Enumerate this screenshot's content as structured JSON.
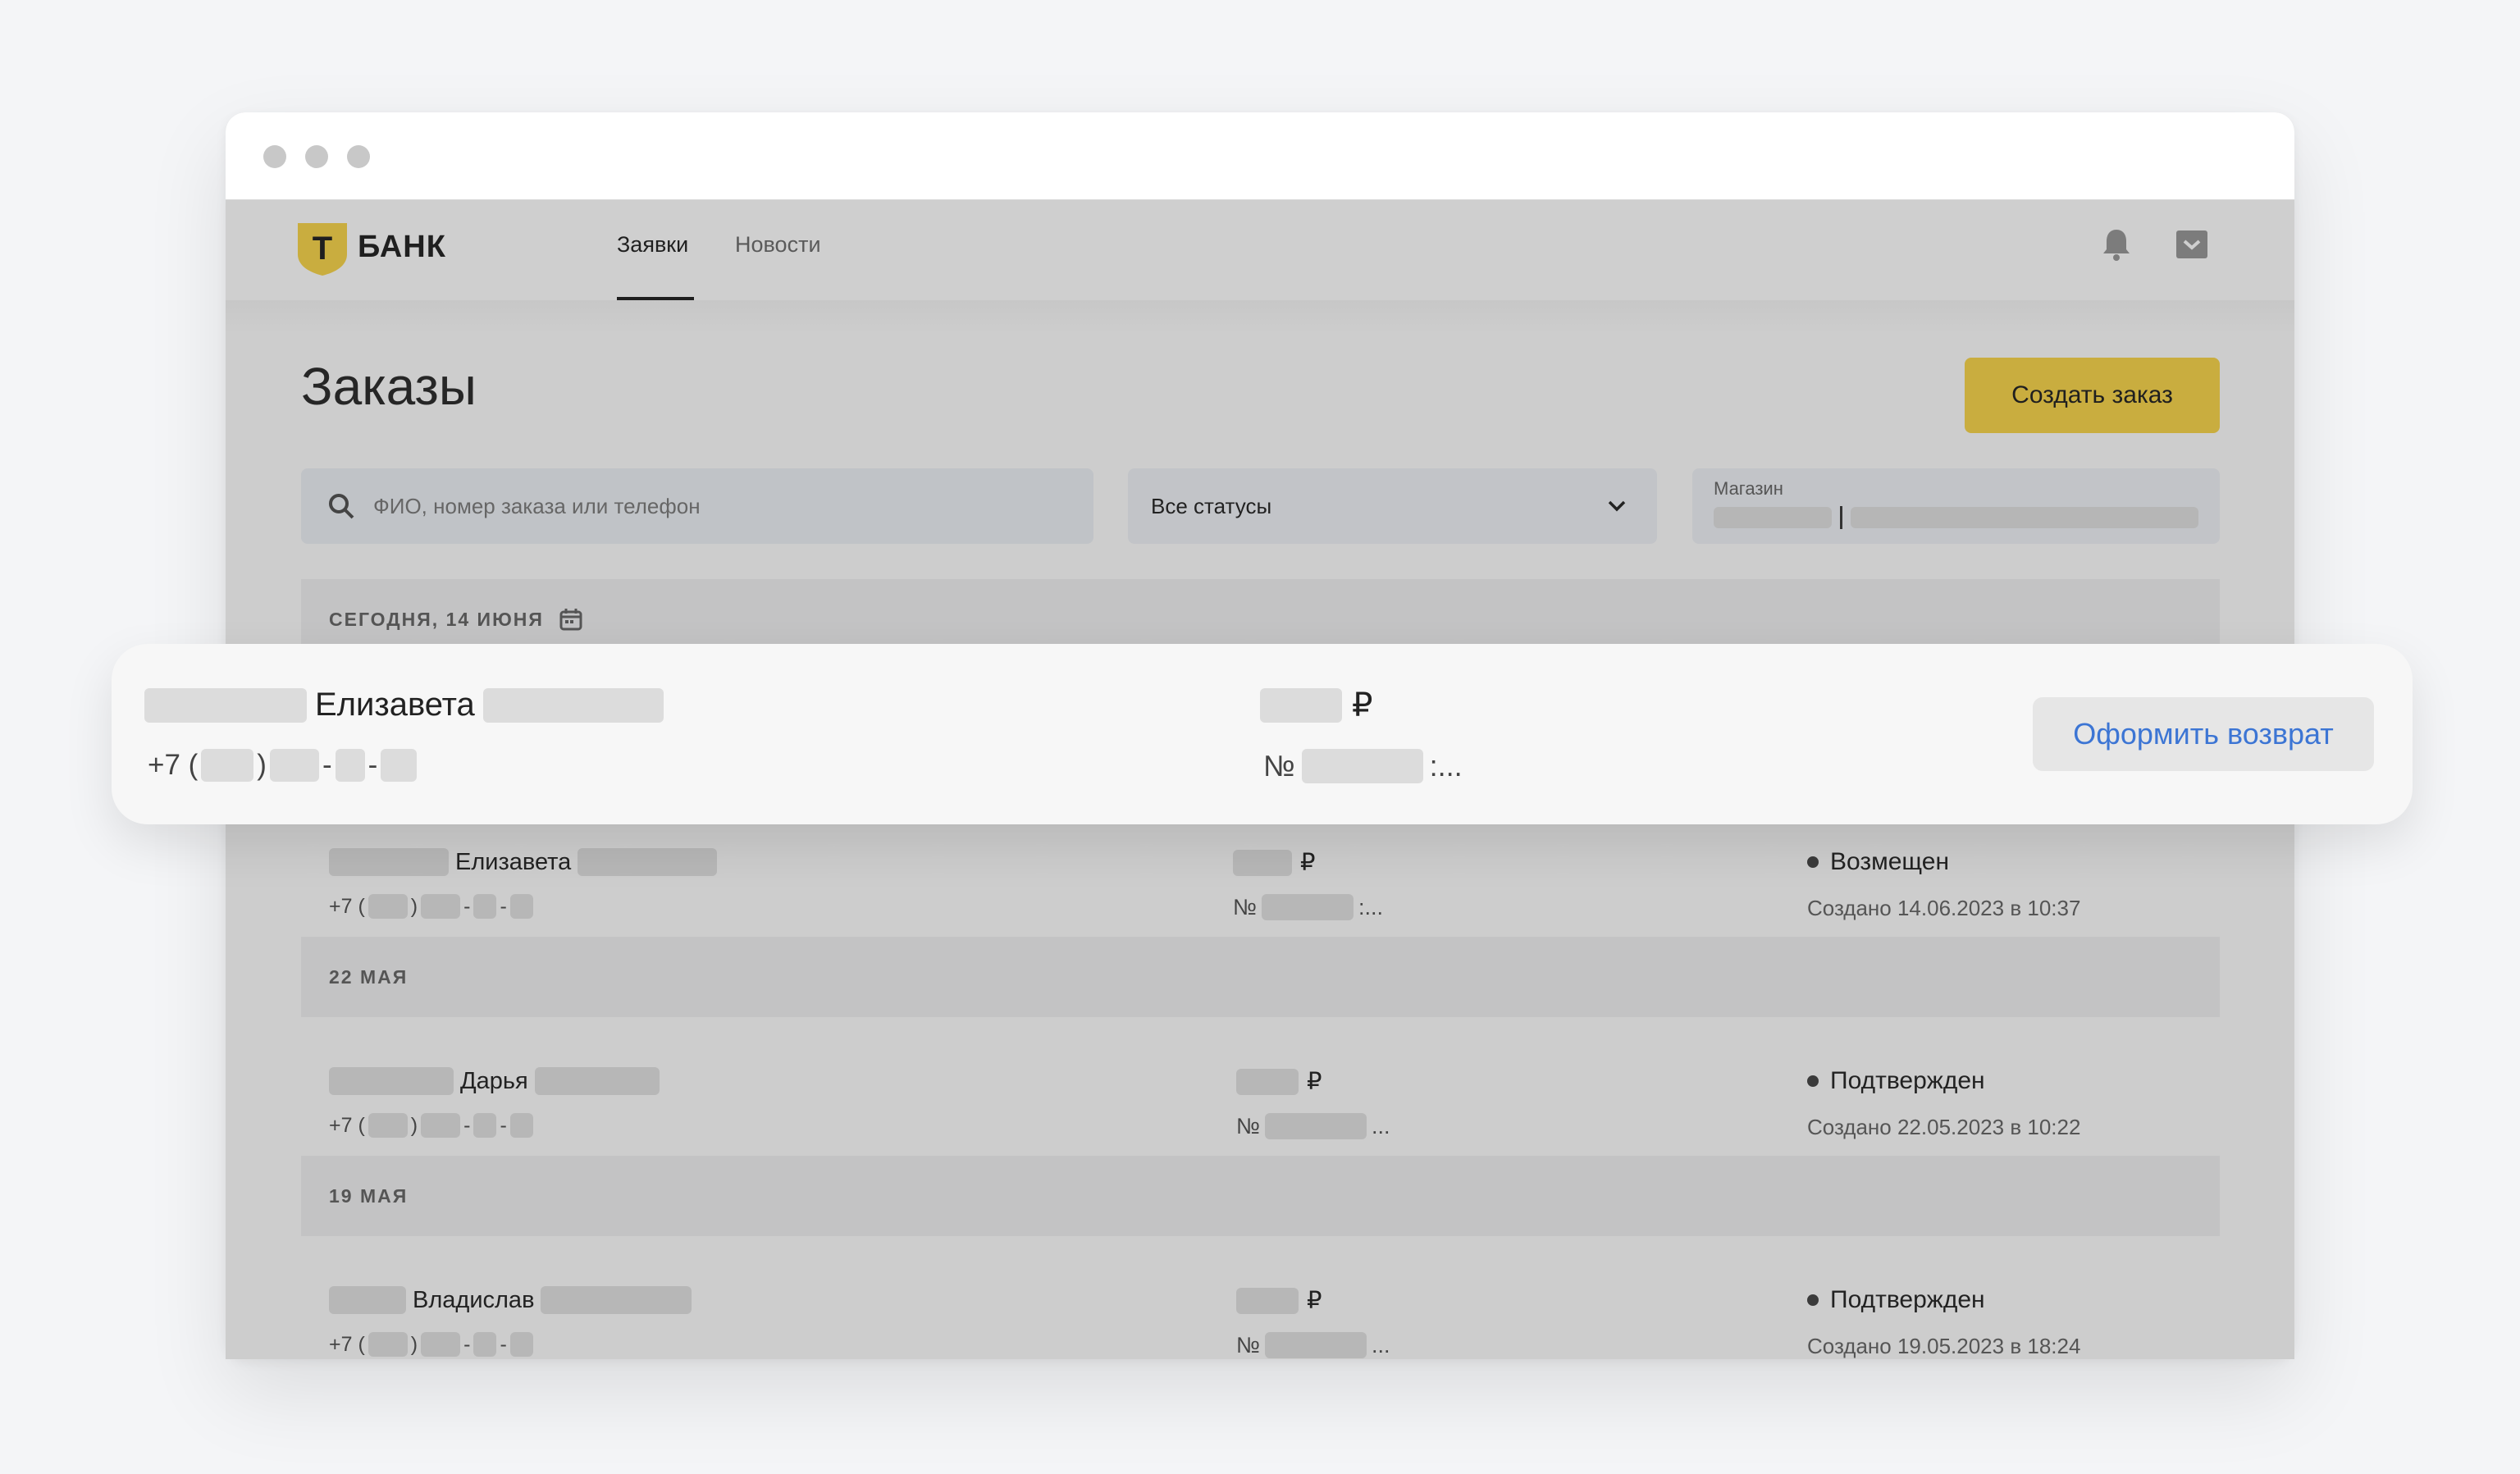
{
  "header": {
    "logo_letter": "Т",
    "logo_text": "БАНК",
    "nav": [
      {
        "label": "Заявки",
        "active": true
      },
      {
        "label": "Новости",
        "active": false
      }
    ],
    "icons": [
      "bell-icon",
      "inbox-icon"
    ]
  },
  "page": {
    "title": "Заказы",
    "create_button": "Создать заказ"
  },
  "filters": {
    "search_placeholder": "ФИО, номер заказа или телефон",
    "status_value": "Все статусы",
    "store_label": "Магазин"
  },
  "groups": [
    {
      "date_label": "СЕГОДНЯ, 14 ИЮНЯ",
      "calendar_icon": "calendar-icon"
    },
    {
      "date_label": "22 МАЯ"
    },
    {
      "date_label": "19 МАЯ"
    }
  ],
  "highlight": {
    "name": "Елизавета",
    "phone_prefix": "+7 (",
    "currency": "₽",
    "number_prefix": "№",
    "number_suffix": ":...",
    "refund_button": "Оформить возврат"
  },
  "orders": [
    {
      "name": "Елизавета",
      "phone_prefix": "+7 (",
      "currency": "₽",
      "number_prefix": "№",
      "number_suffix": ":...",
      "status": "Возмещен",
      "created": "Создано 14.06.2023 в 10:37"
    },
    {
      "name": "Дарья",
      "phone_prefix": "+7 (",
      "currency": "₽",
      "number_prefix": "№",
      "number_suffix": "...",
      "status": "Подтвержден",
      "created": "Создано 22.05.2023 в 10:22"
    },
    {
      "name": "Владислав",
      "phone_prefix": "+7 (",
      "currency": "₽",
      "number_prefix": "№",
      "number_suffix": "...",
      "status": "Подтвержден",
      "created": "Создано 19.05.2023 в 18:24"
    }
  ],
  "colors": {
    "accent": "#c9ad3f",
    "link": "#3c75d4",
    "overlay_gray": "#cdcdcd"
  }
}
